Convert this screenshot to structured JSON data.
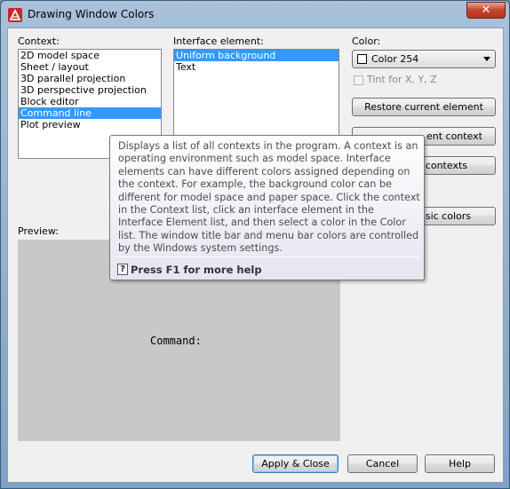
{
  "window": {
    "title": "Drawing Window Colors",
    "close_symbol": "✕"
  },
  "context": {
    "label": "Context:",
    "items": [
      {
        "label": "2D model space",
        "selected": false
      },
      {
        "label": "Sheet / layout",
        "selected": false
      },
      {
        "label": "3D parallel projection",
        "selected": false
      },
      {
        "label": "3D perspective projection",
        "selected": false
      },
      {
        "label": "Block editor",
        "selected": false
      },
      {
        "label": "Command line",
        "selected": true
      },
      {
        "label": "Plot preview",
        "selected": false
      }
    ]
  },
  "interface_element": {
    "label": "Interface element:",
    "items": [
      {
        "label": "Uniform background",
        "selected": true
      },
      {
        "label": "Text",
        "selected": false
      }
    ]
  },
  "color": {
    "label": "Color:",
    "selected_value": "Color 254",
    "tint_label": "Tint for X, Y, Z",
    "tint_checked": false
  },
  "buttons": {
    "restore_element": "Restore current element",
    "restore_context": "ent context",
    "restore_all": "l contexts",
    "classic": "ssic colors",
    "apply_close": "Apply & Close",
    "cancel": "Cancel",
    "help": "Help"
  },
  "preview": {
    "label": "Preview:",
    "text": "Command:"
  },
  "tooltip": {
    "body": "Displays a list of all contexts in the program. A context is an operating environment such as model space. Interface elements can have different colors assigned depending on the context. For example, the background color can be different for model space and paper space. Click the context in the Context list, click an interface element in the Interface Element list, and then select a color in the Color list. The window title bar and menu bar colors are controlled by the Windows system settings.",
    "help_glyph": "?",
    "footer": "Press F1 for more help"
  },
  "colors": {
    "selection": "#3399ff",
    "preview_bg": "#c8c8c8",
    "close_red": "#c4432b"
  }
}
